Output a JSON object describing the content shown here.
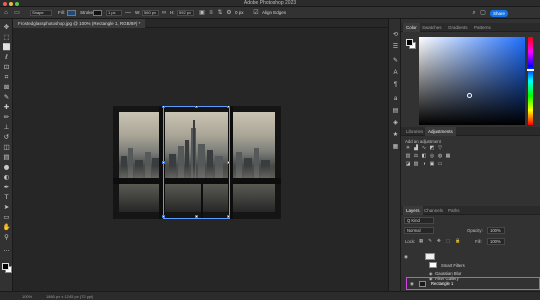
{
  "window": {
    "title": "Adobe Photoshop 2023"
  },
  "options_bar": {
    "tool_mode": "Shape",
    "fill_label": "Fill:",
    "stroke_label": "Stroke:",
    "stroke_size": "1 px",
    "w_label": "W:",
    "w_value": "560 px",
    "h_label": "H:",
    "h_value": "592 px",
    "align_edges_label": "Align Edges",
    "share_label": "Share",
    "stroke_width_value": "0 px"
  },
  "document": {
    "tab_label": "Frostedglassphotoshop.jpg @ 100% (Rectangle 1, RGB/8#) *"
  },
  "status_bar": {
    "zoom": "100%",
    "doc_info": "1860 px x 1245 px (72 ppi)"
  },
  "color_panel": {
    "tabs": [
      "Color",
      "Swatches",
      "Gradients",
      "Patterns"
    ],
    "active_tab": "Color",
    "field_hue": "#1f6fff"
  },
  "adjustments_panel": {
    "tabs": [
      "Libraries",
      "Adjustments"
    ],
    "active_tab": "Adjustments",
    "add_label": "Add an adjustment"
  },
  "layers_panel": {
    "tabs": [
      "Layers",
      "Channels",
      "Paths"
    ],
    "active_tab": "Layers",
    "filter_kind": "Q Kind",
    "blend_mode": "Normal",
    "opacity_label": "Opacity:",
    "opacity_value": "100%",
    "lock_label": "Lock:",
    "fill_label": "Fill:",
    "fill_value": "100%",
    "rows": [
      {
        "name": "",
        "type": "layer"
      },
      {
        "name": "Smart Filters",
        "type": "smart-filters"
      },
      {
        "name": "Gaussian Blur",
        "type": "filter"
      },
      {
        "name": "Filter Gallery",
        "type": "filter"
      },
      {
        "name": "Rectangle 1",
        "type": "shape",
        "selected": true
      }
    ]
  },
  "colors": {
    "accent_blue": "#1473e6",
    "selection_blue": "#5b9dff",
    "highlight_magenta": "#d247e3",
    "panel_bg": "#323232",
    "canvas_bg": "#262626"
  },
  "icons": {
    "toolbar": [
      "move-icon",
      "artboard-icon",
      "marquee-icon",
      "lasso-icon",
      "object-select-icon",
      "crop-icon",
      "frame-icon",
      "eyedropper-icon",
      "healing-icon",
      "brush-icon",
      "stamp-icon",
      "history-brush-icon",
      "eraser-icon",
      "gradient-icon",
      "blur-icon",
      "dodge-icon",
      "pen-icon",
      "type-icon",
      "path-select-icon",
      "rectangle-icon",
      "hand-icon",
      "zoom-icon",
      "more-icon"
    ],
    "strip": [
      "history-icon",
      "properties-icon",
      "brush-settings-icon",
      "character-icon",
      "paragraph-icon",
      "glyphs-icon",
      "libraries-icon",
      "3d-icon",
      "shapes-icon",
      "patterns-icon"
    ]
  }
}
